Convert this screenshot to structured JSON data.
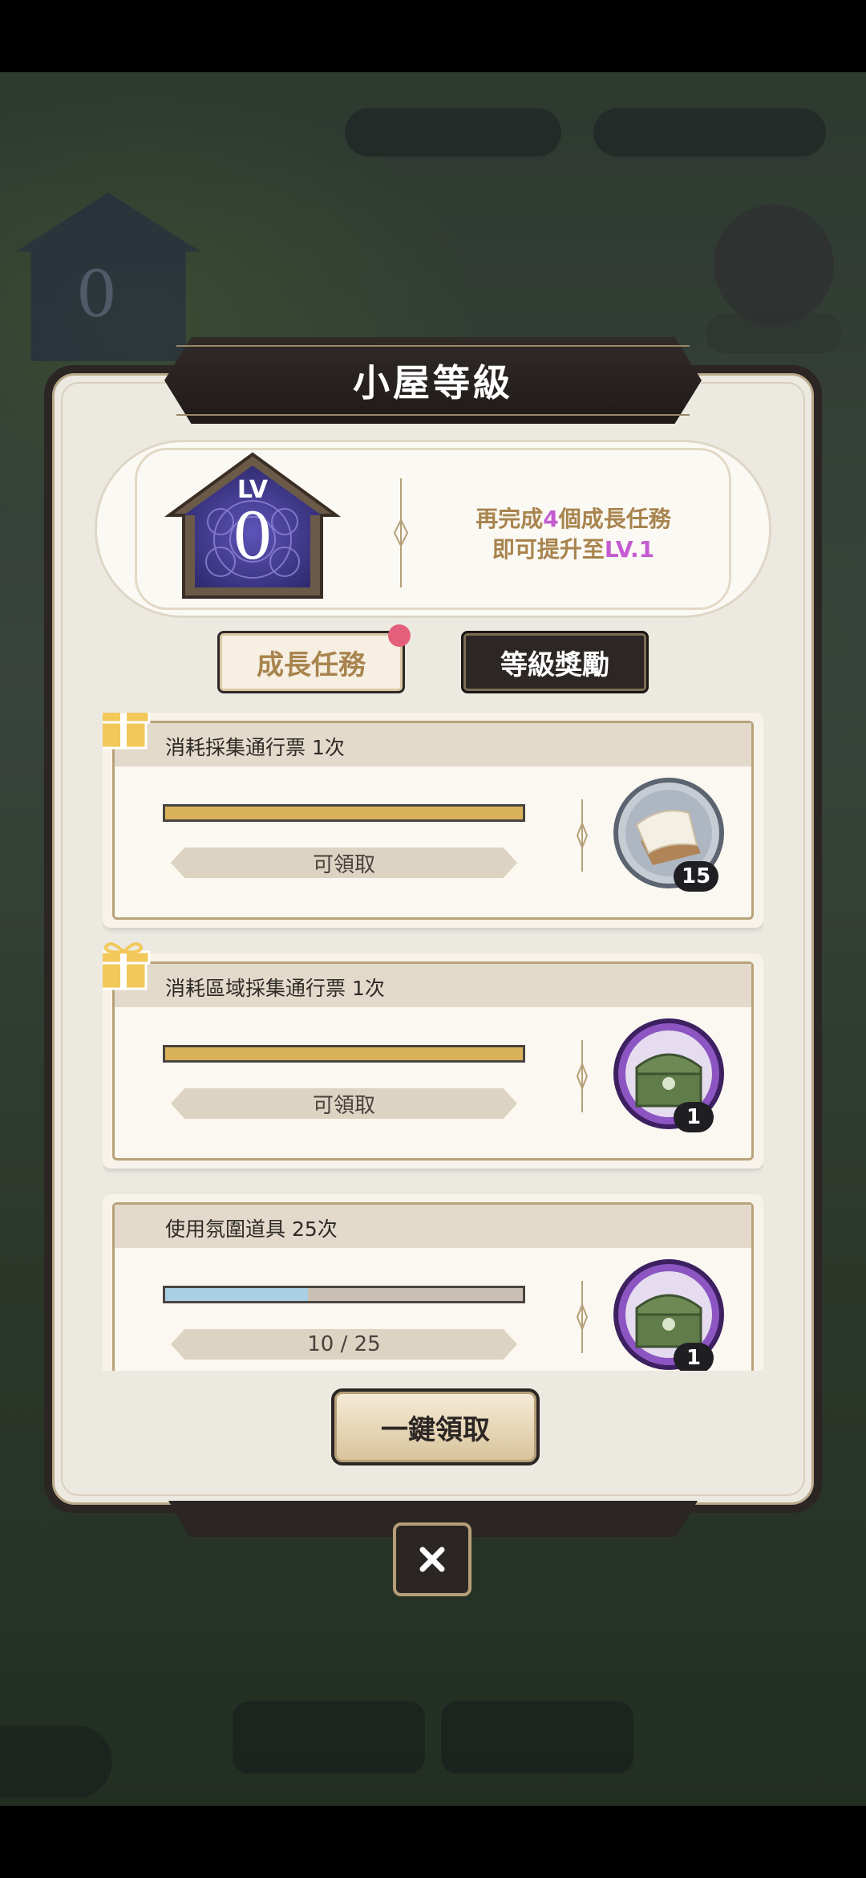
{
  "dialog": {
    "title": "小屋等級",
    "level": {
      "label": "LV",
      "value": "0",
      "hint_line1_pre": "再完成",
      "hint_count": "4",
      "hint_line1_post": "個成長任務",
      "hint_line2_pre": "即可提升至",
      "hint_target": "LV.1"
    },
    "tabs": [
      {
        "label": "成長任務",
        "active": true,
        "has_notification": true
      },
      {
        "label": "等級獎勵",
        "active": false
      }
    ],
    "tasks": [
      {
        "title": "消耗採集通行票 1次",
        "progress": 1.0,
        "state": "可領取",
        "reward_icon": "scroll-paper-icon",
        "reward_count": "15",
        "claimable": true
      },
      {
        "title": "消耗區域採集通行票 1次",
        "progress": 1.0,
        "state": "可領取",
        "reward_icon": "green-chest-icon",
        "reward_count": "1",
        "claimable": true
      },
      {
        "title": "使用氛圍道具 25次",
        "progress": 0.4,
        "state": "10 / 25",
        "reward_icon": "green-chest-icon",
        "reward_count": "1",
        "claimable": false
      }
    ],
    "claim_all_label": "一鍵領取"
  },
  "colors": {
    "gold_text": "#a8844e",
    "accent_purple": "#c45bd0",
    "progress_complete": "#d9b15a",
    "progress_partial": "#a9cfe4",
    "notification_dot": "#e4607a"
  }
}
